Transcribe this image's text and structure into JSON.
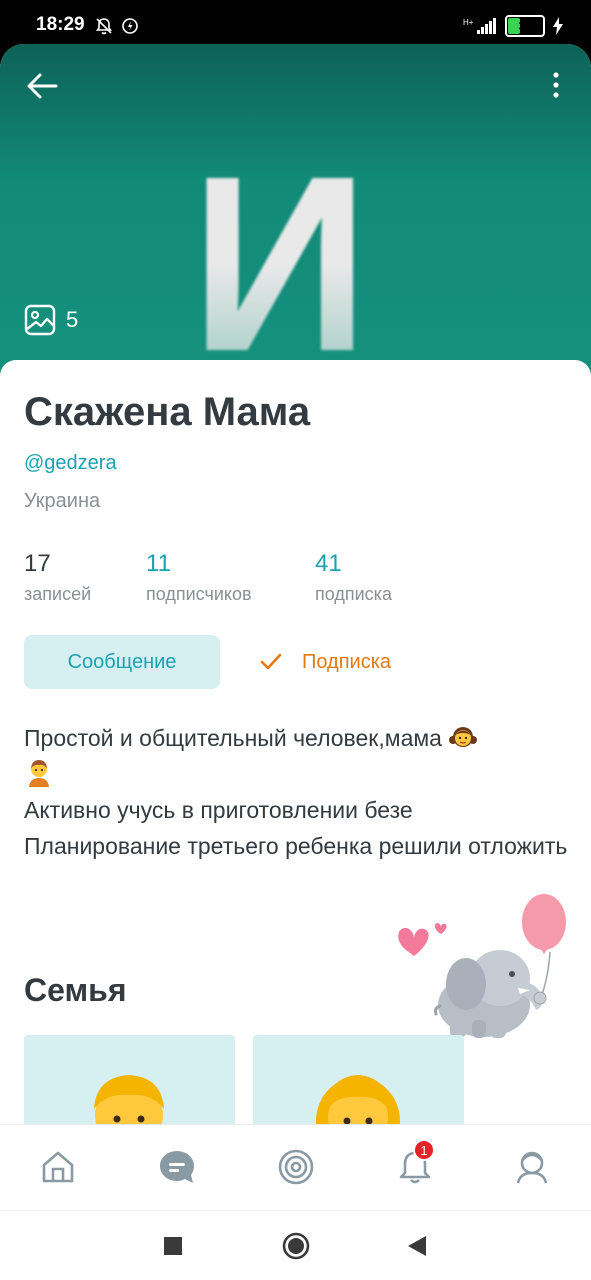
{
  "status_bar": {
    "time": "18:29",
    "battery": "32",
    "battery_level": 0.32
  },
  "cover": {
    "letter": "И",
    "photos_count": "5"
  },
  "profile": {
    "name": "Скажена Мама",
    "handle": "@gedzera",
    "location": "Украина",
    "stats": [
      {
        "value": "17",
        "label": "записей"
      },
      {
        "value": "11",
        "label": "подписчиков"
      },
      {
        "value": "41",
        "label": "подписка"
      }
    ],
    "message_button": "Сообщение",
    "subscribe_button": "Подписка",
    "bio": [
      "Простой и общительный человек,мама",
      "Активно учусь в приготовлении безе",
      "Планирование третьего ребенка решили отложить"
    ],
    "section_title": "Семья"
  },
  "tabbar": {
    "items": [
      "home-icon",
      "chat-icon",
      "target-icon",
      "bell-icon",
      "profile-icon"
    ],
    "notification_badge": "1"
  },
  "colors": {
    "accent": "#1aa3b0",
    "orange": "#e17a12",
    "cover": "#128a78"
  }
}
